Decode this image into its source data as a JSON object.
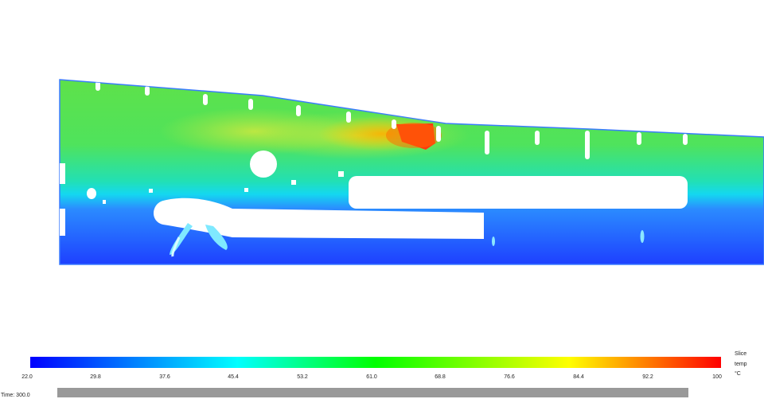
{
  "legend": {
    "title_lines": [
      "Slice",
      "temp",
      "°C"
    ],
    "ticks": [
      "22.0",
      "29.8",
      "37.6",
      "45.4",
      "53.2",
      "61.0",
      "68.8",
      "76.6",
      "84.4",
      "92.2",
      "100"
    ],
    "colors": [
      "#0000ff",
      "#00ffff",
      "#00ff00",
      "#ffff00",
      "#ff0000"
    ]
  },
  "time": {
    "label": "Time: 300.0"
  }
}
